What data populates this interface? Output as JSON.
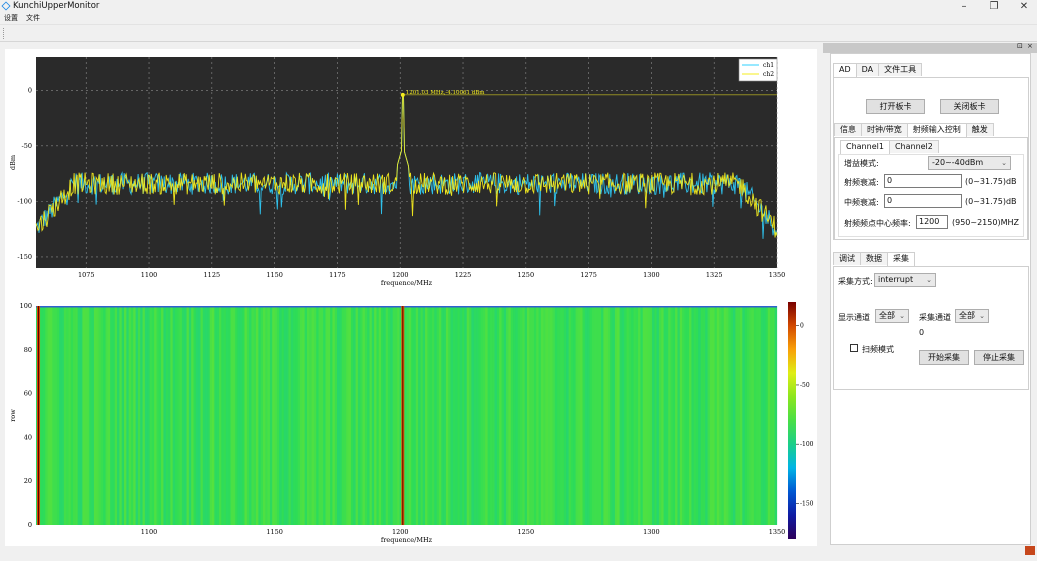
{
  "window": {
    "title": "KunchiUpperMonitor",
    "controls": [
      "–",
      "❐",
      "✕"
    ]
  },
  "menu": [
    "设置",
    "文件"
  ],
  "dock": {
    "float_label": "⊡",
    "close_label": "×"
  },
  "main_tabs": [
    {
      "label": "AD",
      "active": true
    },
    {
      "label": "DA",
      "active": false
    },
    {
      "label": "文件工具",
      "active": false
    }
  ],
  "board_buttons": {
    "open": "打开板卡",
    "close": "关闭板卡"
  },
  "sub_tabs": [
    {
      "label": "信息",
      "active": false
    },
    {
      "label": "时钟/带宽",
      "active": false
    },
    {
      "label": "射频输入控制",
      "active": true
    },
    {
      "label": "触发",
      "active": false
    }
  ],
  "channel_tabs": [
    {
      "label": "Channel1",
      "active": true
    },
    {
      "label": "Channel2",
      "active": false
    }
  ],
  "rf_control": {
    "gain_mode_label": "增益模式:",
    "gain_mode_value": "-20~-40dBm",
    "rf_att_label": "射频衰减:",
    "rf_att_value": "0",
    "rf_att_range": "(0~31.75)dB",
    "if_att_label": "中频衰减:",
    "if_att_value": "0",
    "if_att_range": "(0~31.75)dB",
    "center_freq_label": "射频频点中心频率:",
    "center_freq_value": "1200",
    "center_freq_range": "(950~2150)MHZ"
  },
  "bottom_tabs": [
    {
      "label": "调试",
      "active": false
    },
    {
      "label": "数据",
      "active": false
    },
    {
      "label": "采集",
      "active": true
    }
  ],
  "acquire": {
    "mode_label": "采集方式:",
    "mode_value": "interrupt",
    "display_channel_label": "显示通道",
    "display_channel_value": "全部",
    "acq_channel_label": "采集通道",
    "acq_channel_value": "全部",
    "count": "0",
    "sweep_label": "扫频模式",
    "start_button": "开始采集",
    "stop_button": "停止采集"
  },
  "chart_data": [
    {
      "type": "line",
      "title": "",
      "xlabel": "frequence/MHz",
      "ylabel": "dBm",
      "xlim": [
        1055,
        1350
      ],
      "ylim": [
        -160,
        30
      ],
      "xticks": [
        1075,
        1100,
        1125,
        1150,
        1175,
        1200,
        1225,
        1250,
        1275,
        1300,
        1325,
        1350
      ],
      "yticks": [
        0,
        -50,
        -100,
        -150
      ],
      "grid": true,
      "background": "#2a2a2a",
      "legend": {
        "position": "top-right",
        "entries": [
          "ch1",
          "ch2"
        ]
      },
      "annotation": {
        "text": "1201.03 MHz,-4.10061 dBm",
        "x": 1201.03,
        "y": -4.10061
      },
      "series": [
        {
          "name": "ch1",
          "color": "#2fd0ff",
          "noise_floor": -84,
          "peak": {
            "x": 1201.03,
            "y": -4.1
          }
        },
        {
          "name": "ch2",
          "color": "#f5ec1e",
          "noise_floor": -84,
          "peak": {
            "x": 1201.03,
            "y": -4.1
          }
        }
      ],
      "edge_rolloff": {
        "low_start": 1055,
        "low_end": 1070,
        "high_start": 1335,
        "high_end": 1350,
        "edge_level": -125
      }
    },
    {
      "type": "heatmap",
      "title": "",
      "xlabel": "frequence/MHz",
      "ylabel": "row",
      "xlim": [
        1055,
        1350
      ],
      "ylim": [
        0,
        100
      ],
      "xticks": [
        1100,
        1150,
        1200,
        1250,
        1300,
        1350
      ],
      "yticks": [
        0,
        20,
        40,
        60,
        80,
        100
      ],
      "colorbar": {
        "ticks": [
          0,
          -50,
          -100,
          -150
        ],
        "range": [
          -180,
          20
        ]
      },
      "dominant_level": -85,
      "hot_lines": [
        {
          "x": 1056,
          "level": 0
        },
        {
          "x": 1201.03,
          "level": -4
        }
      ]
    }
  ]
}
